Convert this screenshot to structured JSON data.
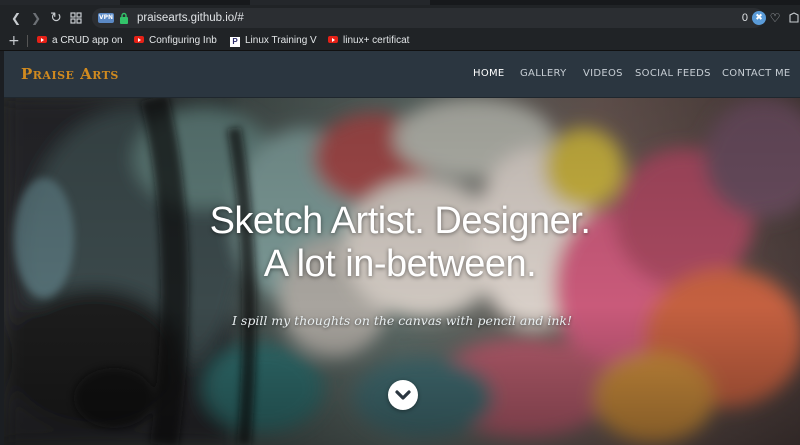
{
  "browser": {
    "url": "praisearts.github.io/#",
    "vpn_label": "VPN",
    "shield_count": "0",
    "bookmarks": [
      {
        "label": "a CRUD app on",
        "icon": "youtube-icon"
      },
      {
        "label": "Configuring Inb",
        "icon": "youtube-icon"
      },
      {
        "label": "Linux Training V",
        "icon": "linux-foundation-icon"
      },
      {
        "label": "linux+ certificat",
        "icon": "youtube-icon"
      }
    ]
  },
  "site": {
    "brand": "Praise Arts",
    "nav": [
      {
        "label": "HOME",
        "active": true
      },
      {
        "label": "GALLERY",
        "active": false
      },
      {
        "label": "VIDEOS",
        "active": false
      },
      {
        "label": "SOCIAL FEEDS",
        "active": false
      },
      {
        "label": "CONTACT ME",
        "active": false
      }
    ],
    "hero": {
      "headline_line1": "Sketch Artist. Designer.",
      "headline_line2": "A lot in-between.",
      "tagline": "I spill my thoughts on the canvas with pencil and ink!"
    }
  },
  "colors": {
    "brand": "#d08a1f",
    "navbar_bg": "#2b3640",
    "chrome_bg": "#202326"
  }
}
